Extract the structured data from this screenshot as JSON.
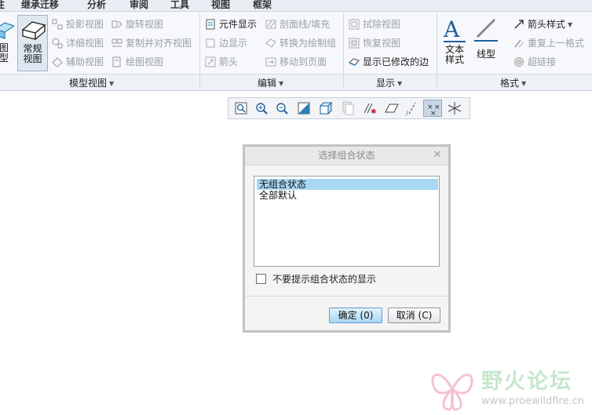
{
  "tabs": [
    "注",
    "继承迁移",
    "分析",
    "审阅",
    "工具",
    "视图",
    "框架"
  ],
  "model_views_group": {
    "label": "模型视图",
    "big_buttons": [
      {
        "label_line1": "图",
        "label_line2": "型",
        "icon": "partial-3d-view-icon"
      },
      {
        "label_line1": "常规",
        "label_line2": "视图",
        "icon": "general-view-icon"
      }
    ],
    "items": [
      {
        "label": "投影视图",
        "icon": "projected-view-icon"
      },
      {
        "label": "详细视图",
        "icon": "detailed-view-icon"
      },
      {
        "label": "辅助视图",
        "icon": "auxiliary-view-icon"
      },
      {
        "label": "旋转视图",
        "icon": "revolved-view-icon"
      },
      {
        "label": "复制并对齐视图",
        "icon": "copy-align-view-icon"
      },
      {
        "label": "绘图视图",
        "icon": "drawing-view-icon"
      }
    ]
  },
  "edit_group": {
    "label": "编辑",
    "items": [
      {
        "label": "元件显示",
        "icon": "component-display-icon"
      },
      {
        "label": "边显示",
        "icon": "edge-display-icon"
      },
      {
        "label": "箭头",
        "icon": "arrow-icon"
      },
      {
        "label": "剖面线/填充",
        "icon": "hatch-fill-icon"
      },
      {
        "label": "转换为绘制组",
        "icon": "convert-draft-group-icon"
      },
      {
        "label": "移动到页面",
        "icon": "move-to-sheet-icon"
      }
    ]
  },
  "display_group": {
    "label": "显示",
    "items": [
      {
        "label": "拭除视图",
        "icon": "erase-view-icon"
      },
      {
        "label": "恢复视图",
        "icon": "resume-view-icon"
      },
      {
        "label": "显示已修改的边",
        "icon": "show-modified-edges-icon"
      }
    ]
  },
  "format_group": {
    "label": "格式",
    "big_buttons": [
      {
        "label_line1": "文本",
        "label_line2": "样式",
        "icon": "text-style-icon"
      },
      {
        "label_line1": "线型",
        "label_line2": "",
        "icon": "line-style-icon"
      }
    ],
    "items": [
      {
        "label": "箭头样式",
        "icon": "arrow-style-icon"
      },
      {
        "label": "重复上一格式",
        "icon": "repeat-format-icon"
      },
      {
        "label": "超链接",
        "icon": "hyperlink-icon"
      }
    ]
  },
  "mini_toolbar": {
    "buttons": [
      "refit-icon",
      "zoom-in-icon",
      "zoom-out-icon",
      "repaint-icon",
      "display-style-icon",
      "saved-views-icon",
      "datum-display-icon",
      "plane-display-icon",
      "axis-display-icon",
      "point-display-icon",
      "csys-display-icon"
    ]
  },
  "dialog": {
    "title": "选择组合状态",
    "options": [
      "无组合状态",
      "全部默认"
    ],
    "checkbox_label": "不要提示组合状态的显示",
    "ok_label": "确定 (0)",
    "cancel_label": "取消 (C)"
  },
  "watermark": {
    "title": "野火论坛",
    "url": "www.proewildfire.cn"
  },
  "colors": {
    "selection": "#a8d8f3",
    "primary_button": "#a9d6f4"
  }
}
